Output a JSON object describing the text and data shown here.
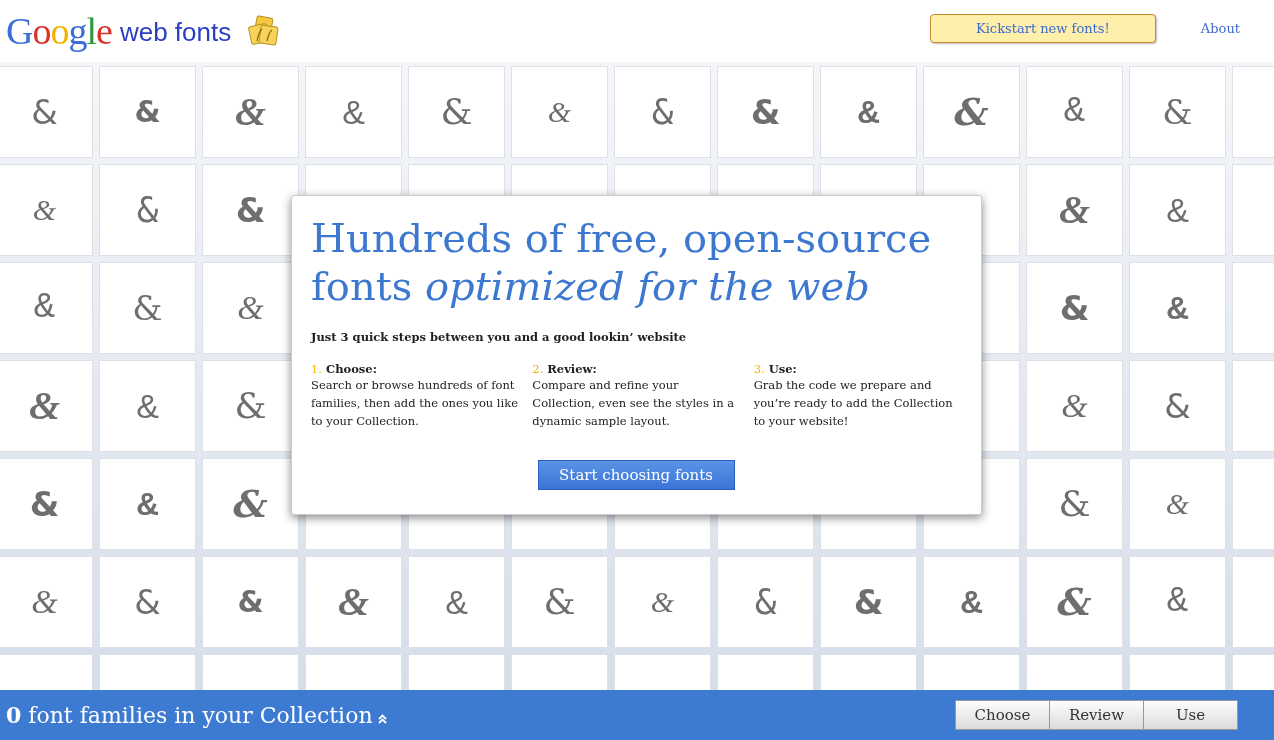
{
  "header": {
    "logo": "Google",
    "product": "web fonts",
    "kickstart_button": "Kickstart new fonts!",
    "about_link": "About"
  },
  "tile_rows": [
    {
      "left": [
        "&",
        "&",
        "&",
        "&",
        "&",
        "&",
        "&",
        "&",
        "&",
        "&",
        "&",
        "&"
      ]
    },
    {
      "left": [
        "&",
        "&",
        "&"
      ],
      "right": [
        "&",
        "&"
      ]
    },
    {
      "left": [
        "&",
        "&",
        "&"
      ],
      "right": [
        "&",
        "&"
      ]
    },
    {
      "left": [
        "&",
        "&",
        "&"
      ],
      "right": [
        "&",
        "&"
      ]
    },
    {
      "left": [
        "&",
        "&",
        "&"
      ],
      "right": [
        "&",
        "&"
      ]
    },
    {
      "left": [
        "&",
        "&",
        "&",
        "&",
        "&",
        "&",
        "&",
        "&",
        "&",
        "&",
        "&",
        "&"
      ]
    }
  ],
  "dialog": {
    "title": "Hundreds of free, open-source fonts *optimized for the web*",
    "subtitle": "Just 3 quick steps between you and a good lookin’ website",
    "steps": [
      {
        "number": "1.",
        "title": "Choose:",
        "text": "Search or browse hundreds of font families, then add the ones you like to your Collection."
      },
      {
        "number": "2.",
        "title": "Review:",
        "text": "Compare and refine your Collection, even see the styles in a dynamic sample layout."
      },
      {
        "number": "3.",
        "title": "Use:",
        "text": "Grab the code we prepare and you’re ready to add the Collection to your website!"
      }
    ],
    "button": "Start choosing fonts"
  },
  "footer": {
    "collection_count": "**0** font families in your Collection",
    "steps": [
      {
        "label": "Choose",
        "selected": false
      },
      {
        "label": "Review",
        "selected": false
      },
      {
        "label": "Use",
        "selected": false
      }
    ]
  }
}
